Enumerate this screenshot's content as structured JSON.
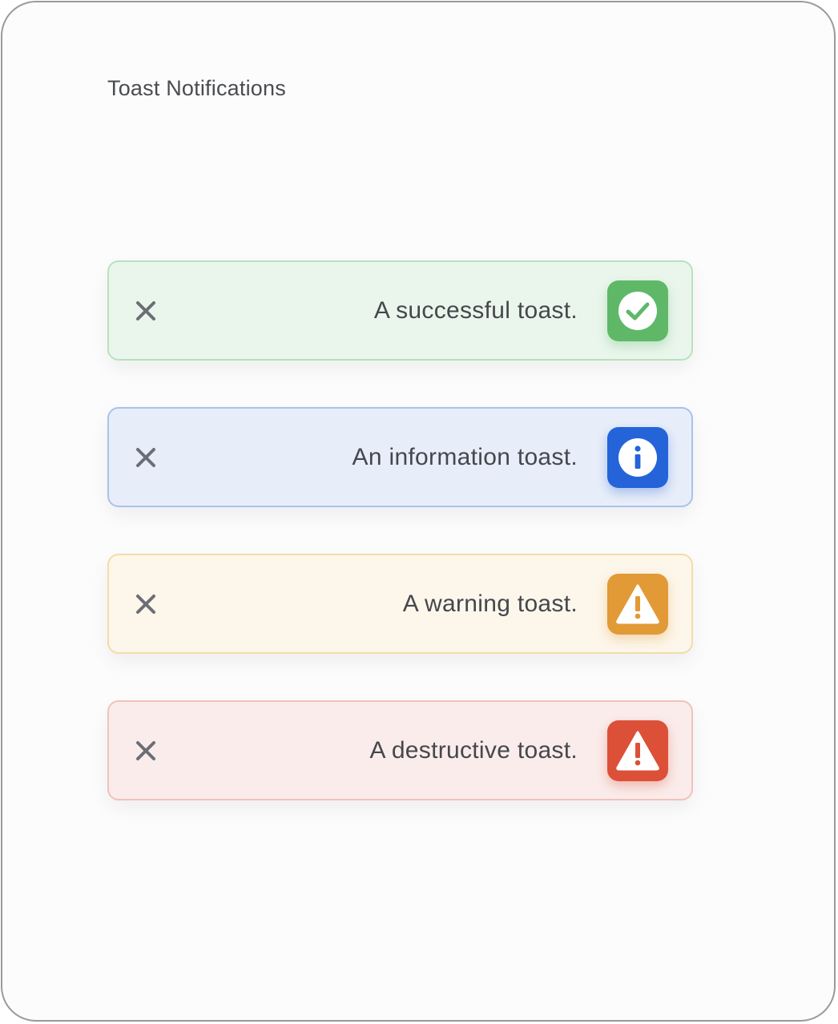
{
  "page": {
    "title": "Toast Notifications"
  },
  "toasts": [
    {
      "variant": "success",
      "message": "A successful toast.",
      "icon": "check-circle-icon",
      "colors": {
        "background": "#eaf6ec",
        "border": "#b8e1c0",
        "badge": "#5fb868"
      }
    },
    {
      "variant": "information",
      "message": "An information toast.",
      "icon": "info-circle-icon",
      "colors": {
        "background": "#e8eef9",
        "border": "#a9c2ec",
        "badge": "#2563d9"
      }
    },
    {
      "variant": "warning",
      "message": "A warning toast.",
      "icon": "warning-triangle-icon",
      "colors": {
        "background": "#fdf6ea",
        "border": "#f3dca9",
        "badge": "#e29a36"
      }
    },
    {
      "variant": "destructive",
      "message": "A destructive toast.",
      "icon": "warning-triangle-icon",
      "colors": {
        "background": "#faecea",
        "border": "#f0c2bd",
        "badge": "#dc5038"
      }
    }
  ],
  "close_icon": {
    "name": "close-icon",
    "color": "#6b6e76"
  }
}
